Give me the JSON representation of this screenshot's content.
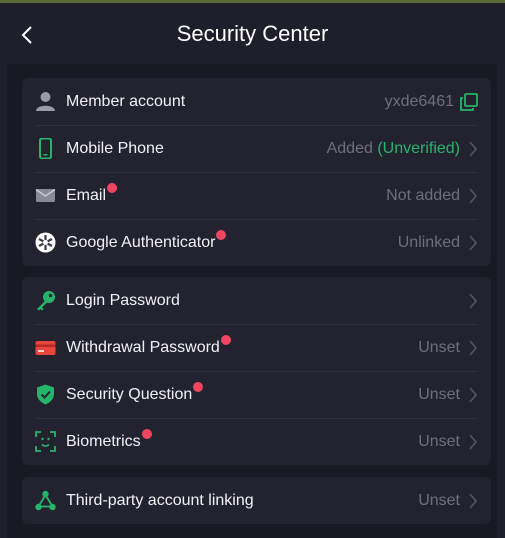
{
  "header": {
    "title": "Security Center"
  },
  "group1": {
    "member": {
      "label": "Member account",
      "value": "yxde6461"
    },
    "phone": {
      "label": "Mobile Phone",
      "status": "Added",
      "status_note": "(Unverified)"
    },
    "email": {
      "label": "Email",
      "value": "Not added"
    },
    "google": {
      "label": "Google Authenticator",
      "value": "Unlinked"
    }
  },
  "group2": {
    "login": {
      "label": "Login Password"
    },
    "withdrawal": {
      "label": "Withdrawal Password",
      "value": "Unset"
    },
    "question": {
      "label": "Security Question",
      "value": "Unset"
    },
    "biometrics": {
      "label": "Biometrics",
      "value": "Unset"
    }
  },
  "group3": {
    "thirdparty": {
      "label": "Third-party account linking",
      "value": "Unset"
    }
  },
  "colors": {
    "background": "#1f1f2c",
    "card": "#232330",
    "accent_green": "#26b46b",
    "alert_dot": "#f0455f",
    "muted_text": "#6e6e7c"
  },
  "icons": {
    "back": "chevron-left-icon",
    "member": "user-icon",
    "phone": "phone-icon",
    "email": "envelope-icon",
    "google": "authenticator-icon",
    "login": "key-icon",
    "withdrawal": "card-icon",
    "question": "shield-check-icon",
    "biometrics": "face-scan-icon",
    "thirdparty": "share-nodes-icon",
    "copy": "copy-icon",
    "chevron": "chevron-right-icon"
  }
}
